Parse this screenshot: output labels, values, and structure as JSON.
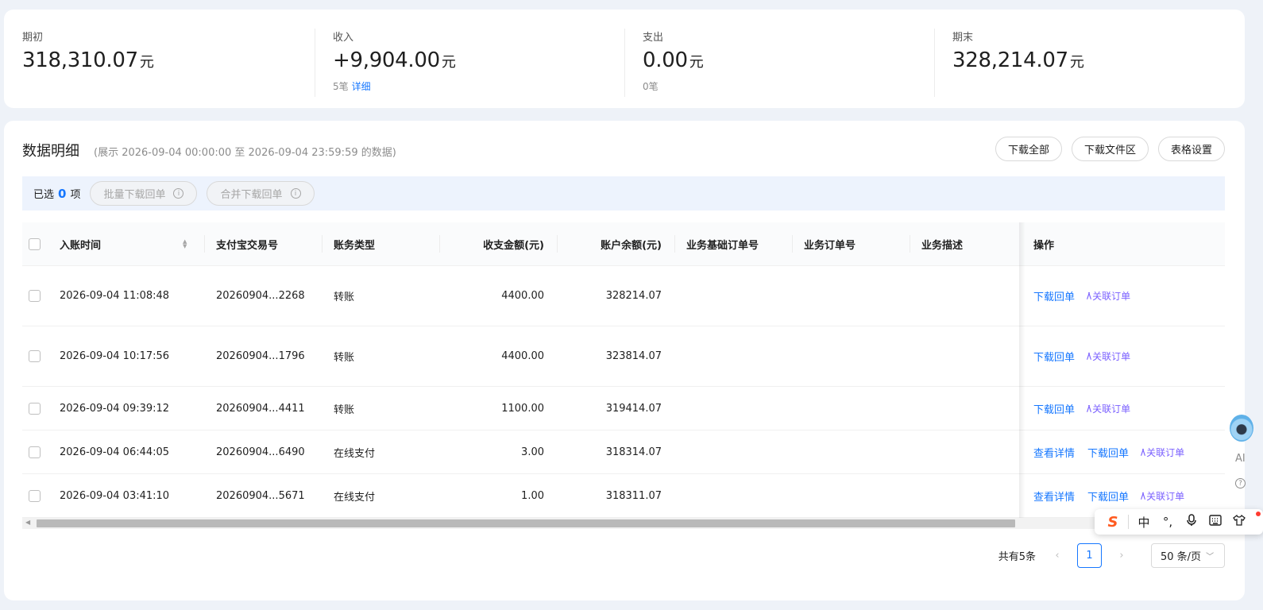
{
  "summary": {
    "opening": {
      "label": "期初",
      "amount": "318,310.07",
      "unit": "元"
    },
    "income": {
      "label": "收入",
      "amount": "+9,904.00",
      "unit": "元",
      "count": "5笔",
      "detail_link": "详细"
    },
    "expense": {
      "label": "支出",
      "amount": "0.00",
      "unit": "元",
      "count": "0笔"
    },
    "closing": {
      "label": "期末",
      "amount": "328,214.07",
      "unit": "元"
    }
  },
  "details": {
    "title": "数据明细",
    "range": "(展示 2026-09-04 00:00:00 至 2026-09-04 23:59:59 的数据)",
    "buttons": {
      "download_all": "下载全部",
      "download_files": "下载文件区",
      "table_settings": "表格设置"
    }
  },
  "selection": {
    "prefix": "已选",
    "count": "0",
    "suffix": "项",
    "batch_download": "批量下载回单",
    "merge_download": "合并下载回单"
  },
  "table": {
    "headers": {
      "time": "入账时间",
      "alipay_no": "支付宝交易号",
      "type": "账务类型",
      "amount": "收支金额(元)",
      "balance": "账户余额(元)",
      "base_order": "业务基础订单号",
      "order": "业务订单号",
      "desc": "业务描述",
      "ops": "操作"
    },
    "rows": [
      {
        "time": "2026-09-04 11:08:48",
        "alipay_no": "20260904...2268",
        "type": "转账",
        "amount": "4400.00",
        "balance": "328214.07",
        "actions": [
          "下载回单"
        ],
        "ai": "关联订单"
      },
      {
        "time": "2026-09-04 10:17:56",
        "alipay_no": "20260904...1796",
        "type": "转账",
        "amount": "4400.00",
        "balance": "323814.07",
        "actions": [
          "下载回单"
        ],
        "ai": "关联订单"
      },
      {
        "time": "2026-09-04 09:39:12",
        "alipay_no": "20260904...4411",
        "type": "转账",
        "amount": "1100.00",
        "balance": "319414.07",
        "actions": [
          "下载回单"
        ],
        "ai": "关联订单"
      },
      {
        "time": "2026-09-04 06:44:05",
        "alipay_no": "20260904...6490",
        "type": "在线支付",
        "amount": "3.00",
        "balance": "318314.07",
        "actions": [
          "查看详情",
          "下载回单"
        ],
        "ai": "关联订单"
      },
      {
        "time": "2026-09-04 03:41:10",
        "alipay_no": "20260904...5671",
        "type": "在线支付",
        "amount": "1.00",
        "balance": "318311.07",
        "actions": [
          "查看详情",
          "下载回单"
        ],
        "ai": "关联订单"
      }
    ]
  },
  "pagination": {
    "total": "共有5条",
    "current": "1",
    "page_size": "50 条/页"
  },
  "ime": {
    "chinese": "中",
    "punct": "°,"
  },
  "side": {
    "ai": "AI"
  },
  "colors": {
    "primary": "#1677ff",
    "ai_purple": "#7b61ff"
  }
}
